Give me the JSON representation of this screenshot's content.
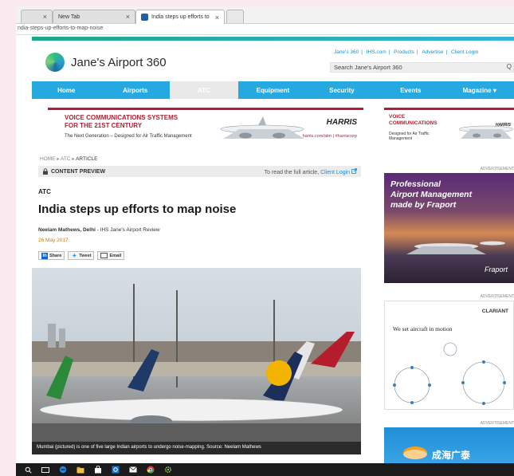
{
  "browser": {
    "tabs": [
      {
        "label": "",
        "close": "×"
      },
      {
        "label": "New Tab",
        "close": "×"
      },
      {
        "label": "India steps up efforts to",
        "close": "×"
      }
    ],
    "address": "ndia-steps-up-efforts-to-map-noise"
  },
  "site": {
    "logo": "Jane's Airport 360",
    "toplinks": [
      "Jane's 360",
      "IHS.com",
      "Products",
      "Advertise",
      "Client Login"
    ],
    "search_placeholder": "Search Jane's Airport 360",
    "search_icon": "Q",
    "nav": [
      "Home",
      "Airports",
      "ATC",
      "Equipment",
      "Security",
      "Events",
      "Magazine ▾"
    ],
    "accent": "#26a9e0"
  },
  "banner": {
    "headline_1": "VOICE COMMUNICATIONS SYSTEMS",
    "headline_2": "FOR THE 21ST CENTURY",
    "sub": "The Next Generation – Designed for Air Traffic Management",
    "brand": "HARRIS",
    "url": "harris.com/atm | #harriscorp"
  },
  "breadcrumb": {
    "home": "HOME",
    "sep1": "▸",
    "atc": "ATC",
    "sep2": "▸",
    "current": "ARTICLE"
  },
  "preview": {
    "label": "CONTENT PREVIEW",
    "message": "To read the full article,",
    "link": "Client Login"
  },
  "article": {
    "section": "ATC",
    "title": "India steps up efforts to map noise",
    "author": "Neelam Mathews, Delhi",
    "source": " - IHS Jane's Airport Review",
    "date": "26 May 2017",
    "share": {
      "linkedin": "Share",
      "twitter": "Tweet",
      "email": "Email"
    },
    "caption": "Mumbai (pictured) is one of five large Indian airports to undergo noise-mapping. Source: Neelam Mathews"
  },
  "sidebar": {
    "ad1_h1": "VOICE",
    "ad1_h2": "COMMUNICATIONS",
    "ad1_s1": "Designed for Air Traffic",
    "ad1_s2": "Management",
    "ad1_brand": "HARRIS",
    "adlabel": "ADVERTISEMENT",
    "ad2_l1": "Professional",
    "ad2_l2": "Airport Management",
    "ad2_l3": "made by Fraport",
    "ad2_brand": "Fraport",
    "ad3_brand": "CLARIANT",
    "ad3_text": "We set aircraft in motion",
    "ad4_text": "成海广泰"
  },
  "taskbar": {
    "icons": [
      "search-icon",
      "task-view-icon",
      "edge-icon",
      "file-explorer-icon",
      "store-icon",
      "outlook-icon",
      "mail-icon",
      "chrome-icon",
      "settings-icon"
    ]
  }
}
